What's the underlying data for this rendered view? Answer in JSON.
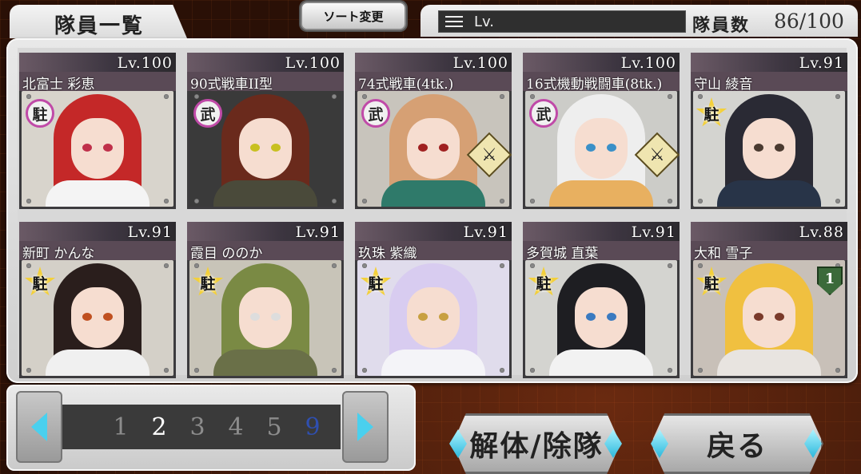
{
  "header": {
    "title": "隊員一覧",
    "sort_button": "ソート変更",
    "filter_label": "Lv.",
    "count_label": "隊員数",
    "count_value": "86/100"
  },
  "members": [
    {
      "name": "北富士 彩恵",
      "level": "Lv.100",
      "role": "駐",
      "badge_style": "circle",
      "extra_icon": "",
      "hair": "#c42828",
      "eye": "#c0304a",
      "outfit": "#f4f4f4",
      "bg": "#d8d4cc"
    },
    {
      "name": "90式戦車II型",
      "level": "Lv.100",
      "role": "武",
      "badge_style": "circle",
      "extra_icon": "",
      "hair": "#6a2a1c",
      "eye": "#c8c020",
      "outfit": "#4a4a3a",
      "bg": "#3a3a3a"
    },
    {
      "name": "74式戦車(4tk.)",
      "level": "Lv.100",
      "role": "武",
      "badge_style": "circle",
      "extra_icon": "crossed-swords",
      "hair": "#d6a074",
      "eye": "#a02020",
      "outfit": "#2f7a6a",
      "bg": "#c8c4bc"
    },
    {
      "name": "16式機動戦闘車(8tk.)",
      "level": "Lv.100",
      "role": "武",
      "badge_style": "circle",
      "extra_icon": "crossed-swords",
      "hair": "#eeeeee",
      "eye": "#3a90c8",
      "outfit": "#e8b060",
      "bg": "#ccccc8"
    },
    {
      "name": "守山 綾音",
      "level": "Lv.91",
      "role": "駐",
      "badge_style": "star",
      "extra_icon": "",
      "hair": "#2a2a34",
      "eye": "#4a3a30",
      "outfit": "#283448",
      "bg": "#d4d4d0"
    },
    {
      "name": "新町 かんな",
      "level": "Lv.91",
      "role": "駐",
      "badge_style": "star",
      "extra_icon": "",
      "hair": "#2a1e1c",
      "eye": "#c05020",
      "outfit": "#f0f0f0",
      "bg": "#d4d0c8"
    },
    {
      "name": "霞目 ののか",
      "level": "Lv.91",
      "role": "駐",
      "badge_style": "star",
      "extra_icon": "",
      "hair": "#7a8a44",
      "eye": "#dddddd",
      "outfit": "#6a7048",
      "bg": "#c8c4b8"
    },
    {
      "name": "玖珠 紫織",
      "level": "Lv.91",
      "role": "駐",
      "badge_style": "star",
      "extra_icon": "",
      "hair": "#d8ccf0",
      "eye": "#c8a040",
      "outfit": "#f4f4f8",
      "bg": "#e0dcec"
    },
    {
      "name": "多賀城 直葉",
      "level": "Lv.91",
      "role": "駐",
      "badge_style": "star",
      "extra_icon": "",
      "hair": "#1e1e22",
      "eye": "#3a7ac0",
      "outfit": "#f2f2f2",
      "bg": "#d4d4d0"
    },
    {
      "name": "大和 雪子",
      "level": "Lv.88",
      "role": "駐",
      "badge_style": "star",
      "extra_icon": "shield-1",
      "hair": "#f0c040",
      "eye": "#7a3a2a",
      "outfit": "#e8e4e0",
      "bg": "#c8c0b8"
    }
  ],
  "shield_number": "1",
  "pager": {
    "pages": [
      "1",
      "2",
      "3",
      "4",
      "5",
      "9"
    ],
    "current_page": "2"
  },
  "buttons": {
    "dismiss": "解体/除隊",
    "back": "戻る"
  }
}
